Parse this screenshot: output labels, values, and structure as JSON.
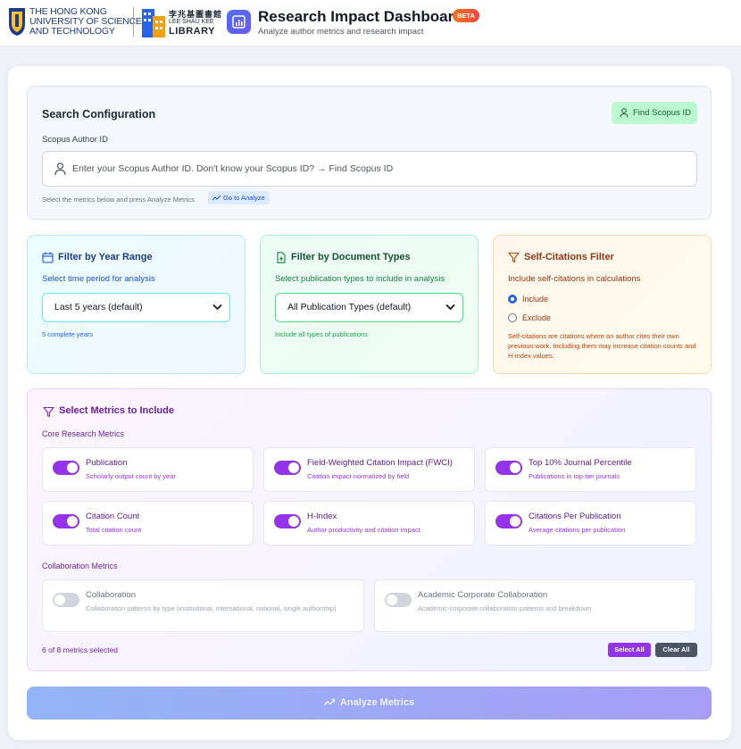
{
  "header": {
    "university_lines": [
      "THE HONG KONG",
      "UNIVERSITY OF SCIENCE",
      "AND TECHNOLOGY"
    ],
    "library_cn": "李兆基圖書館",
    "library_en": "LEE SHAU KEE",
    "library_word": "LIBRARY",
    "app_title": "Research Impact Dashboard",
    "beta_label": "BETA",
    "app_subtitle": "Analyze author metrics and research impact"
  },
  "search": {
    "title": "Search Configuration",
    "find_button": "Find Scopus ID",
    "author_label": "Scopus Author ID",
    "placeholder": "Enter your Scopus Author ID. Don't know your Scopus ID? → Find Scopus ID",
    "hint": "Select the metrics below and press Analyze Metrics",
    "go_analyze": "Go to Analyze"
  },
  "filters": {
    "year": {
      "title": "Filter by Year Range",
      "subtitle": "Select time period for analysis",
      "selected": "Last 5 years (default)",
      "footnote": "5 complete years"
    },
    "doc": {
      "title": "Filter by Document Types",
      "subtitle": "Select publication types to include in analysis",
      "selected": "All Publication Types (default)",
      "footnote": "Include all types of publications"
    },
    "self": {
      "title": "Self-Citations Filter",
      "subtitle": "Include self-citations in calculations",
      "options": [
        "Include",
        "Exclude"
      ],
      "selected": "Include",
      "note": "Self-citations are citations where an author cites their own previous work. Including them may increase citation counts and H-index values."
    }
  },
  "metrics": {
    "title": "Select Metrics to Include",
    "core_label": "Core Research Metrics",
    "core": [
      {
        "name": "Publication",
        "desc": "Scholarly output count by year",
        "enabled": true
      },
      {
        "name": "Field-Weighted Citation Impact (FWCI)",
        "desc": "Citation impact normalized by field",
        "enabled": true
      },
      {
        "name": "Top 10% Journal Percentile",
        "desc": "Publications in top-tier journals",
        "enabled": true
      },
      {
        "name": "Citation Count",
        "desc": "Total citation count",
        "enabled": true
      },
      {
        "name": "H-Index",
        "desc": "Author productivity and citation impact",
        "enabled": true
      },
      {
        "name": "Citations Per Publication",
        "desc": "Average citations per publication",
        "enabled": true
      }
    ],
    "collab_label": "Collaboration Metrics",
    "collab": [
      {
        "name": "Collaboration",
        "desc": "Collaboration patterns by type (institutional, international, national, single authorship)",
        "enabled": false
      },
      {
        "name": "Academic Corporate Collaboration",
        "desc": "Academic-corporate collaboration patterns and breakdown",
        "enabled": false
      }
    ],
    "selected_count": "6 of 8 metrics selected",
    "select_all": "Select All",
    "clear_all": "Clear All"
  },
  "analyze_button": "Analyze Metrics",
  "colors": {
    "accent_purple": "#9333ea",
    "accent_blue": "#2563eb",
    "beta_orange": "#f97316"
  }
}
